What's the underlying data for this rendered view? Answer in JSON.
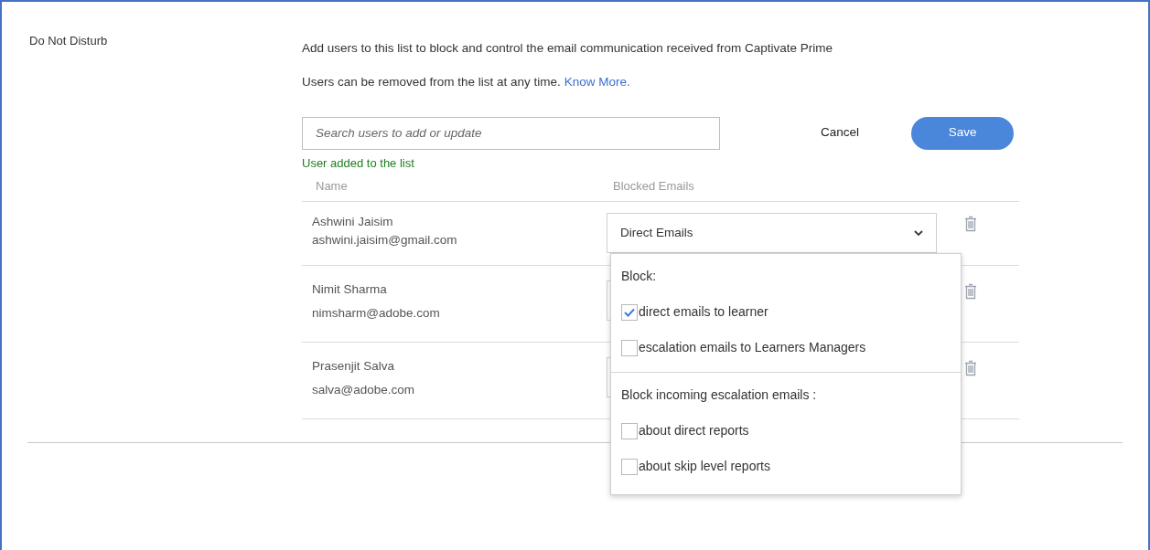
{
  "section": {
    "title": "Do Not Disturb"
  },
  "description": "Add users to this list to block and control the email communication received from Captivate Prime",
  "note": {
    "text": "Users can be removed from the list at any time.",
    "link": "Know More."
  },
  "search": {
    "placeholder": "Search users to add or update"
  },
  "status_message": "User added to the list",
  "buttons": {
    "cancel": "Cancel",
    "save": "Save"
  },
  "table": {
    "columns": [
      "Name",
      "Blocked Emails"
    ],
    "rows": [
      {
        "name": "Ashwini Jaisim",
        "email": "ashwini.jaisim@gmail.com",
        "blocked": "Direct Emails",
        "expanded": true
      },
      {
        "name": "Nimit Sharma",
        "email": "nimsharm@adobe.com",
        "expanded": false
      },
      {
        "name": "Prasenjit Salva",
        "email": "salva@adobe.com",
        "expanded": false
      }
    ]
  },
  "dropdown": {
    "groups": [
      {
        "title": "Block:",
        "options": [
          {
            "label": "direct emails to learner",
            "checked": true
          },
          {
            "label": "escalation emails to Learners Managers",
            "checked": false
          }
        ]
      },
      {
        "title": "Block incoming escalation emails :",
        "options": [
          {
            "label": "about direct reports",
            "checked": false
          },
          {
            "label": "about skip level reports",
            "checked": false
          }
        ]
      }
    ]
  }
}
